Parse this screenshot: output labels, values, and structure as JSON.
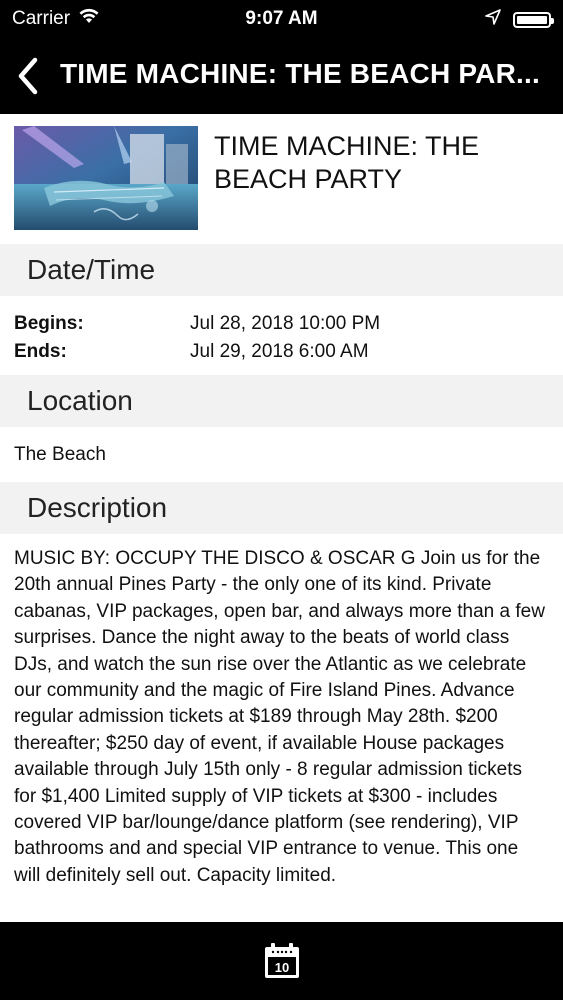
{
  "status_bar": {
    "carrier": "Carrier",
    "time": "9:07 AM",
    "battery_level": 1.0
  },
  "nav": {
    "title": "TIME MACHINE: THE BEACH PAR..."
  },
  "event": {
    "title_line1": "TIME MACHINE: THE",
    "title_line2": "BEACH PARTY"
  },
  "date_time": {
    "header": "Date/Time",
    "begins_label": "Begins:",
    "begins_value": "Jul 28, 2018 10:00 PM",
    "ends_label": "Ends:",
    "ends_value": "Jul 29, 2018 6:00 AM"
  },
  "location": {
    "header": "Location",
    "value": "The Beach"
  },
  "description": {
    "header": "Description",
    "text": "MUSIC BY: OCCUPY THE DISCO & OSCAR G Join us for the 20th annual Pines Party - the only one of its kind. Private cabanas, VIP packages, open bar, and always more than a few surprises. Dance the night away to the beats of world class DJs, and watch the sun rise over the Atlantic as we celebrate our community and the magic of Fire Island Pines. Advance regular admission tickets at $189 through May 28th. $200 thereafter; $250 day of event, if available House packages available through July 15th only - 8 regular admission tickets for $1,400 Limited supply of VIP tickets at $300 - includes covered VIP bar/lounge/dance platform (see rendering), VIP bathrooms and and special VIP entrance to venue. This one will definitely sell out. Capacity limited."
  },
  "tab_bar": {
    "calendar_day": "10"
  },
  "icons": {
    "back": "chevron-left-icon",
    "wifi": "wifi-icon",
    "location": "location-arrow-icon",
    "battery": "battery-icon",
    "calendar": "calendar-icon"
  }
}
